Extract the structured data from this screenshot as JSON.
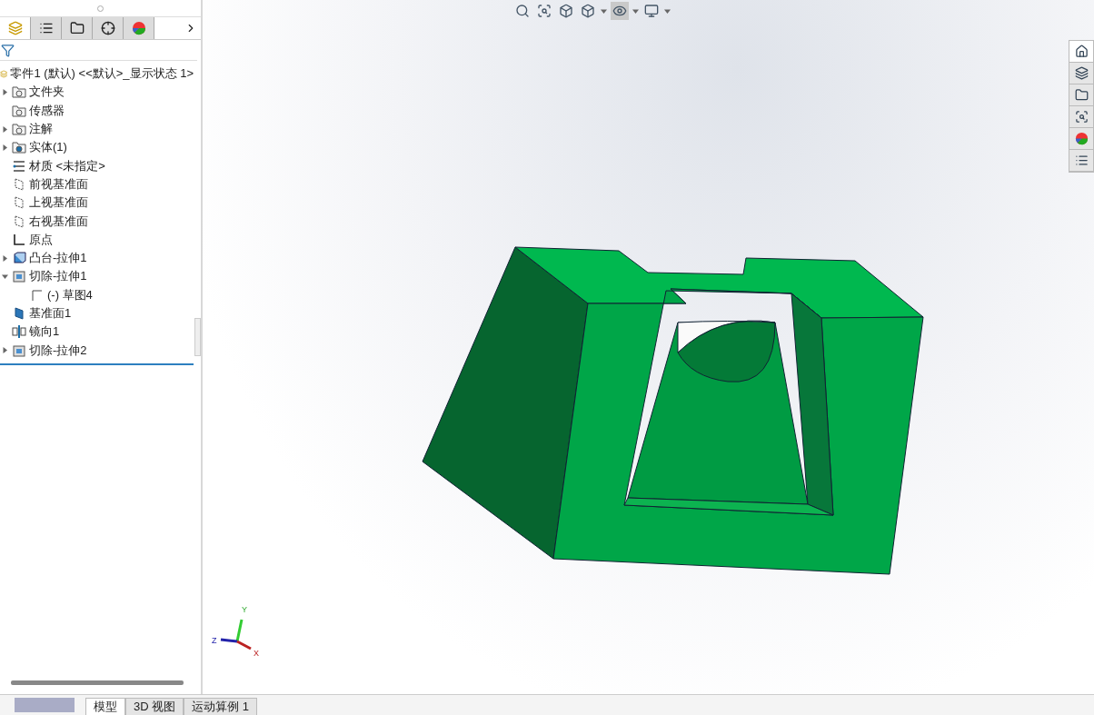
{
  "panel_tabs": [
    {
      "kind": "feature",
      "selected": true
    },
    {
      "kind": "property",
      "selected": false
    },
    {
      "kind": "config",
      "selected": false
    },
    {
      "kind": "dim",
      "selected": false
    },
    {
      "kind": "display",
      "selected": false
    }
  ],
  "tree": {
    "root": "零件1 (默认) <<默认>_显示状态 1>",
    "items": [
      {
        "label": "文件夹",
        "kind": "folder",
        "expanded": false
      },
      {
        "label": "传感器",
        "kind": "sensor"
      },
      {
        "label": "注解",
        "kind": "annotation",
        "expanded": false
      },
      {
        "label": "实体(1)",
        "kind": "body",
        "expanded": false
      },
      {
        "label": "材质 <未指定>",
        "kind": "material"
      },
      {
        "label": "前视基准面",
        "kind": "plane"
      },
      {
        "label": "上视基准面",
        "kind": "plane"
      },
      {
        "label": "右视基准面",
        "kind": "plane"
      },
      {
        "label": "原点",
        "kind": "origin"
      },
      {
        "label": "凸台-拉伸1",
        "kind": "boss",
        "expanded": false
      },
      {
        "label": "切除-拉伸1",
        "kind": "cut",
        "expanded": true,
        "children": [
          {
            "label": "(-) 草图4",
            "kind": "sketch"
          }
        ]
      },
      {
        "label": "基准面1",
        "kind": "refplane"
      },
      {
        "label": "镜向1",
        "kind": "mirror"
      },
      {
        "label": "切除-拉伸2",
        "kind": "cut",
        "expanded": false
      }
    ]
  },
  "triad": {
    "y": "Y",
    "z": "Z",
    "x": "X"
  },
  "bottom_tabs": [
    {
      "label": "模型",
      "selected": true
    },
    {
      "label": "3D 视图",
      "selected": false
    },
    {
      "label": "运动算例 1",
      "selected": false
    }
  ]
}
